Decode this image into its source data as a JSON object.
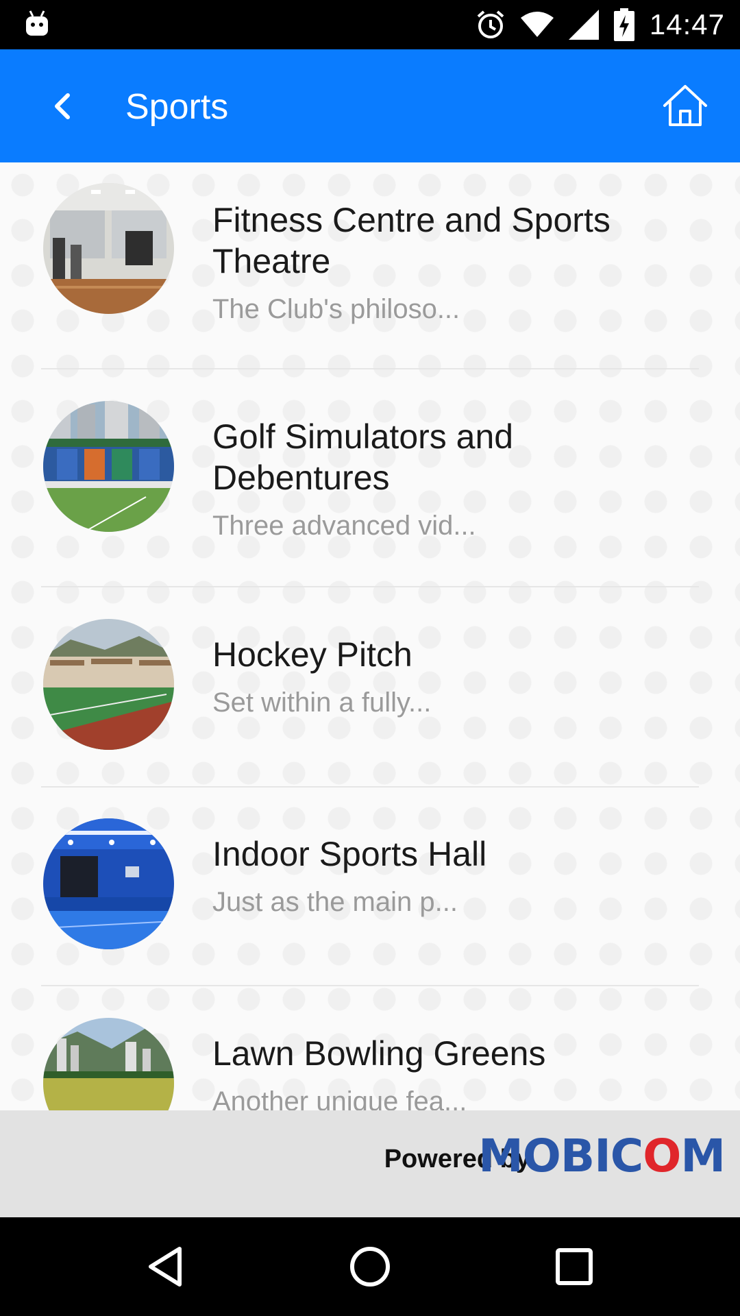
{
  "status_bar": {
    "time": "14:47",
    "icons": [
      "android-icon",
      "alarm-icon",
      "wifi-icon",
      "signal-icon",
      "battery-charging-icon"
    ]
  },
  "app_bar": {
    "title": "Sports",
    "back_icon": "chevron-left-icon",
    "home_icon": "home-icon",
    "color": "#0a7cff"
  },
  "list": {
    "items": [
      {
        "title": "Fitness Centre and Sports Theatre",
        "description": "The Club's philoso...",
        "image": "fitness-centre-photo"
      },
      {
        "title": "Golf Simulators and Debentures",
        "description": "Three advanced vid...",
        "image": "golf-stadium-photo"
      },
      {
        "title": "Hockey Pitch",
        "description": "Set within a fully...",
        "image": "hockey-pitch-photo"
      },
      {
        "title": "Indoor Sports Hall",
        "description": "Just as the main p...",
        "image": "indoor-hall-photo"
      },
      {
        "title": "Lawn Bowling Greens",
        "description": "Another unique fea...",
        "image": "lawn-bowling-photo"
      }
    ]
  },
  "footer": {
    "powered_by": "Powered by",
    "brand_a": "MOBIC",
    "brand_dot": "O",
    "brand_b": "M"
  },
  "nav_bar": {
    "icons": [
      "back-triangle-icon",
      "home-circle-icon",
      "recents-square-icon"
    ]
  }
}
